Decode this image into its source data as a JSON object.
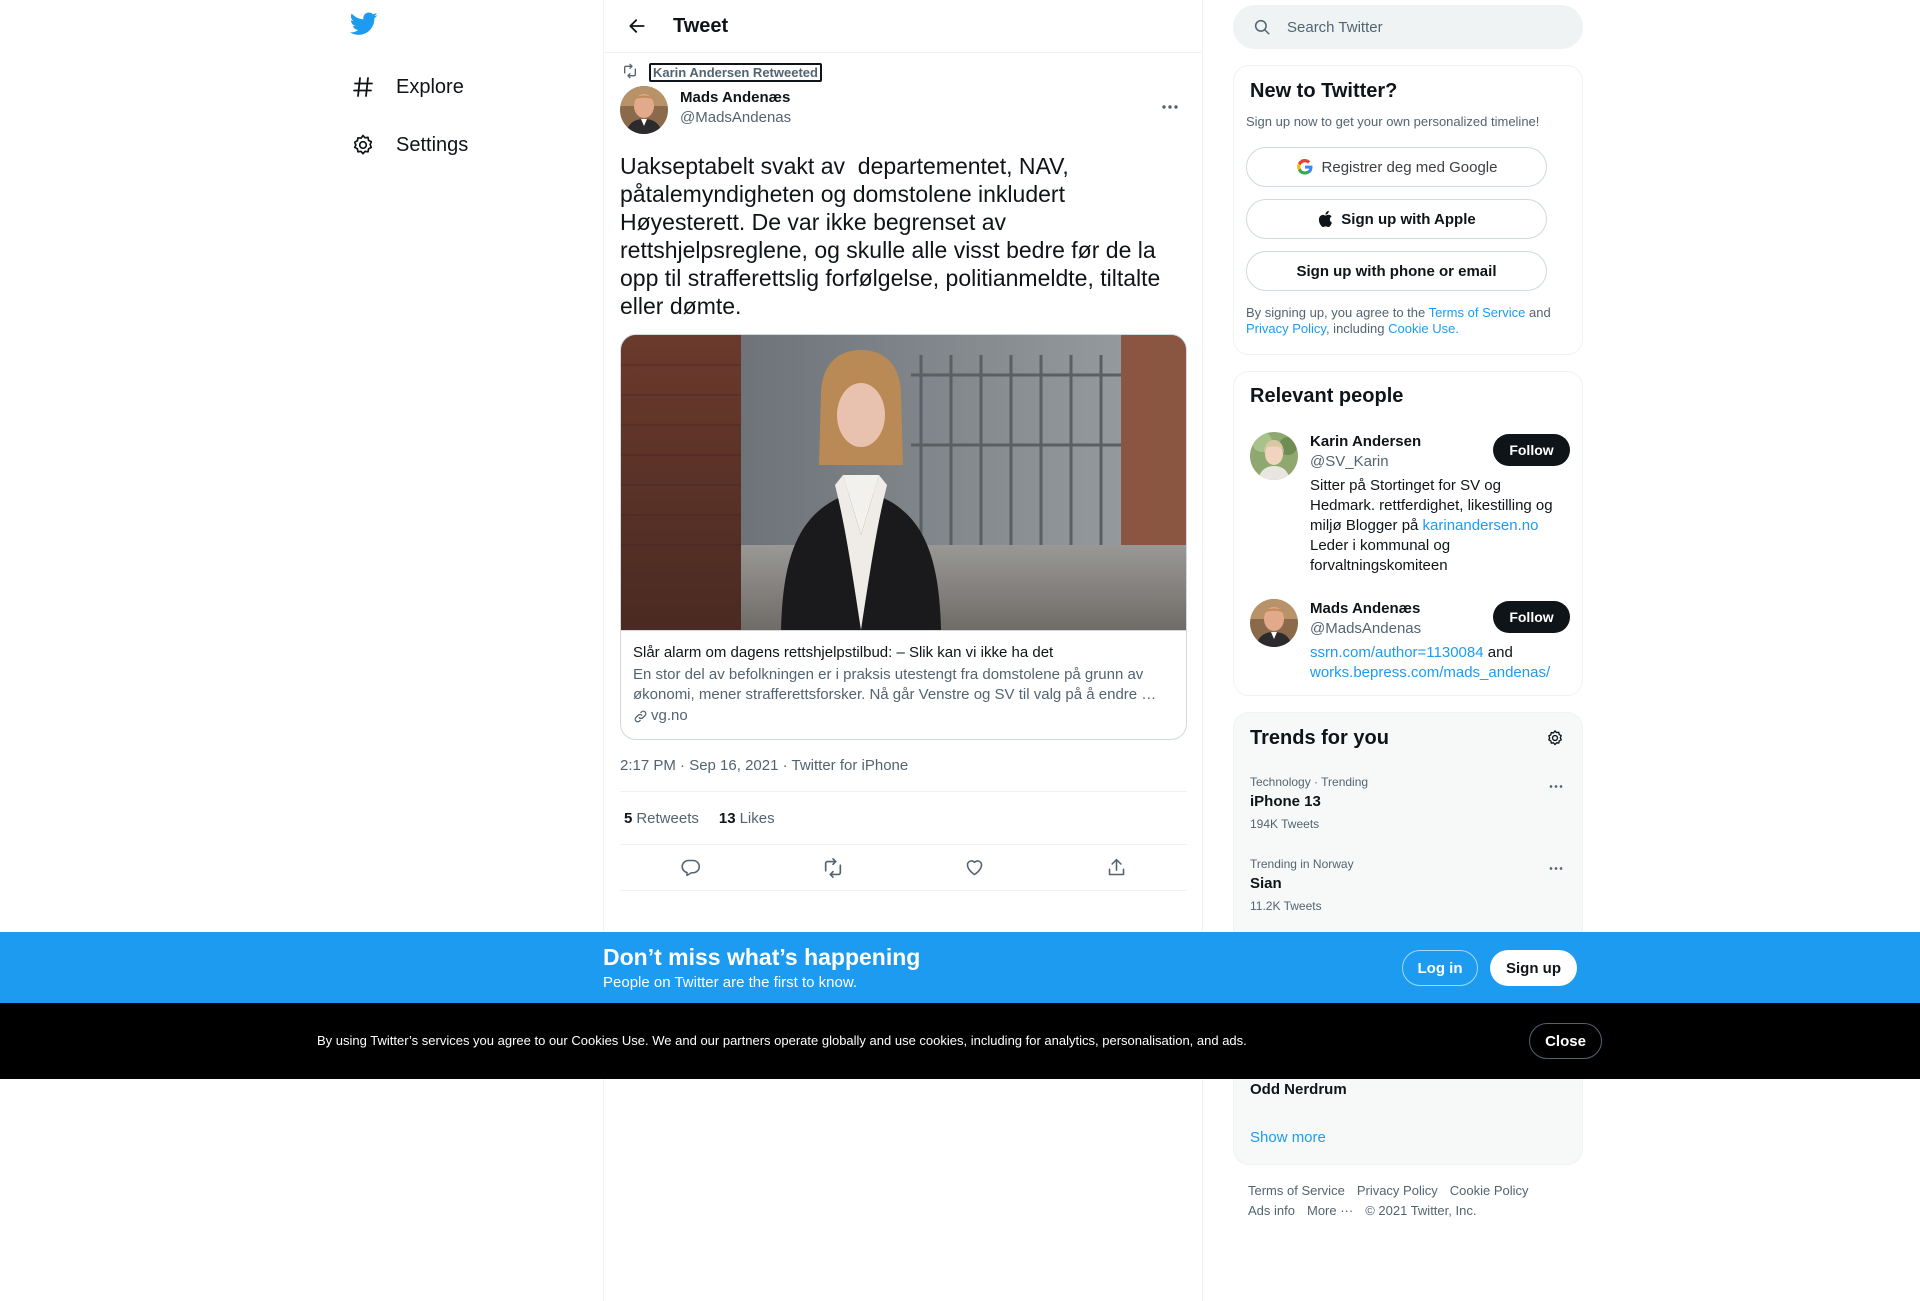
{
  "nav": {
    "items": [
      {
        "label": "Explore",
        "icon": "hashtag-icon"
      },
      {
        "label": "Settings",
        "icon": "gear-icon"
      }
    ]
  },
  "header": {
    "title": "Tweet"
  },
  "tweet": {
    "retweeted_by": "Karin Andersen Retweeted",
    "author_name": "Mads Andenæs",
    "author_handle": "@MadsAndenas",
    "text": "Uakseptabelt svakt av  departementet, NAV, påtalemyndigheten og domstolene inkludert Høyesterett. De var ikke begrenset av rettshjelpsreglene, og skulle alle visst bedre før de la opp til strafferettslig forfølgelse, politianmeldte, tiltalte eller dømte.",
    "card": {
      "title": "Slår alarm om dagens rettshjelpstilbud: – Slik kan vi ikke ha det",
      "description": "En stor del av befolkningen er i praksis utestengt fra domstolene på grunn av økonomi, mener strafferettsforsker. Nå går Venstre og SV til valg på å endre …",
      "domain": "vg.no"
    },
    "meta": "2:17 PM · Sep 16, 2021 · Twitter for iPhone",
    "retweets_count": "5",
    "retweets_label": "Retweets",
    "likes_count": "13",
    "likes_label": "Likes"
  },
  "search": {
    "placeholder": "Search Twitter"
  },
  "signup_panel": {
    "title": "New to Twitter?",
    "subtitle": "Sign up now to get your own personalized timeline!",
    "google_label": "Registrer deg med Google",
    "apple_label": "Sign up with Apple",
    "phone_label": "Sign up with phone or email",
    "legal_prefix": "By signing up, you agree to the ",
    "terms_link": "Terms of Service",
    "legal_and": " and ",
    "privacy_link": "Privacy Policy",
    "legal_including": ", including ",
    "cookie_link": "Cookie Use."
  },
  "relevant_people": {
    "title": "Relevant people",
    "people": [
      {
        "name": "Karin Andersen",
        "handle": "@SV_Karin",
        "bio_prefix": "Sitter på Stortinget for SV og Hedmark. rettferdighet, likestilling og miljø Blogger på ",
        "bio_link": "karinandersen.no",
        "bio_suffix": " Leder i kommunal og forvaltningskomiteen",
        "follow_label": "Follow"
      },
      {
        "name": "Mads Andenæs",
        "handle": "@MadsAndenas",
        "bio_link_1": "ssrn.com/author=1130084",
        "bio_and": " and ",
        "bio_link_2": "works.bepress.com/mads_andenas/",
        "follow_label": "Follow"
      }
    ]
  },
  "trends": {
    "title": "Trends for you",
    "items": [
      {
        "meta": "Technology · Trending",
        "name": "iPhone 13",
        "count": "194K Tweets"
      },
      {
        "meta": "Trending in Norway",
        "name": "Sian",
        "count": "11.2K Tweets"
      }
    ],
    "partial_item": "Odd Nerdrum",
    "show_more": "Show more"
  },
  "footer": {
    "links": [
      "Terms of Service",
      "Privacy Policy",
      "Cookie Policy",
      "Ads info",
      "More ···",
      "© 2021 Twitter, Inc."
    ]
  },
  "banner": {
    "title": "Don’t miss what’s happening",
    "subtitle": "People on Twitter are the first to know.",
    "login_label": "Log in",
    "signup_label": "Sign up"
  },
  "cookie_bar": {
    "text": "By using Twitter’s services you agree to our Cookies Use. We and our partners operate globally and use cookies, including for analytics, personalisation, and ads.",
    "close_label": "Close"
  },
  "colors": {
    "accent": "#1d9bf0",
    "text": "#0f1419",
    "secondary": "#536471",
    "cookie_bg": "#000000"
  }
}
